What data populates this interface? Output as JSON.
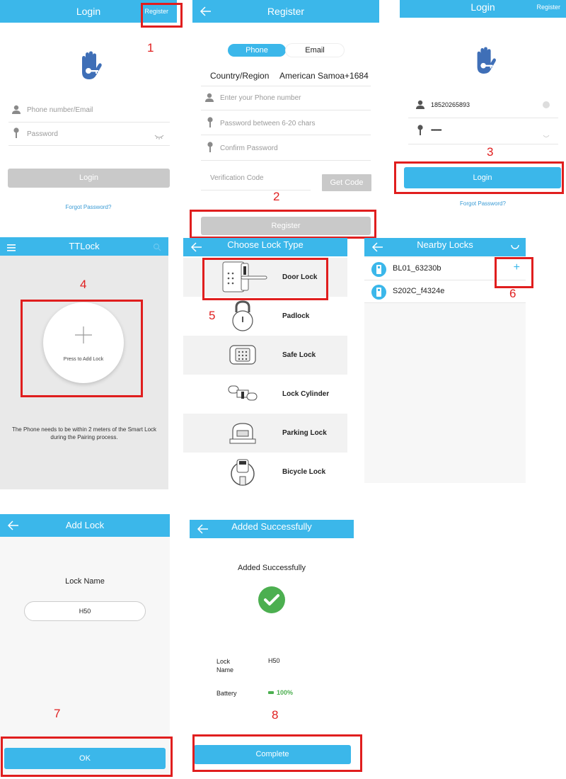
{
  "screen1": {
    "title": "Login",
    "register_link": "Register",
    "phone_placeholder": "Phone number/Email",
    "password_placeholder": "Password",
    "login_button": "Login",
    "forgot_link": "Forgot Password?"
  },
  "screen2": {
    "title": "Register",
    "tab_phone": "Phone",
    "tab_email": "Email",
    "country_label": "Country/Region",
    "country_value": "American Samoa+1684",
    "phone_placeholder": "Enter your Phone number",
    "password_placeholder": "Password between 6-20 chars",
    "confirm_placeholder": "Confirm Password",
    "code_placeholder": "Verification Code",
    "get_code_button": "Get Code",
    "register_button": "Register"
  },
  "screen3": {
    "title": "Login",
    "register_link": "Register",
    "phone_value": "18520265893",
    "password_value": "••••••••••",
    "login_button": "Login",
    "forgot_link": "Forgot Password?"
  },
  "screen4": {
    "title": "TTLock",
    "add_label": "Press to Add Lock",
    "hint": "The Phone needs to be within 2 meters of the Smart Lock during the Pairing process."
  },
  "screen5": {
    "title": "Choose Lock Type",
    "items": [
      {
        "label": "Door Lock",
        "icon": "door-lock-icon"
      },
      {
        "label": "Padlock",
        "icon": "padlock-icon"
      },
      {
        "label": "Safe Lock",
        "icon": "safe-lock-icon"
      },
      {
        "label": "Lock Cylinder",
        "icon": "lock-cylinder-icon"
      },
      {
        "label": "Parking Lock",
        "icon": "parking-lock-icon"
      },
      {
        "label": "Bicycle Lock",
        "icon": "bicycle-lock-icon"
      }
    ]
  },
  "screen6": {
    "title": "Nearby Locks",
    "locks": [
      {
        "name": "BL01_63230b",
        "action": "+"
      },
      {
        "name": "S202C_f4324e"
      }
    ]
  },
  "screen7": {
    "title": "Add Lock",
    "lock_name_label": "Lock Name",
    "lock_name_value": "H50",
    "ok_button": "OK"
  },
  "screen8": {
    "title": "Added Successfully",
    "heading": "Added Successfully",
    "lock_name_label": "Lock\nName",
    "lock_name_value": "H50",
    "battery_label": "Battery",
    "battery_value": "100%",
    "battery_level": 1.0,
    "complete_button": "Complete"
  },
  "steps": [
    "1",
    "2",
    "3",
    "4",
    "5",
    "6",
    "7",
    "8"
  ],
  "colors": {
    "accent": "#3bb7ea",
    "annotation": "#e01e1e",
    "success": "#4caf50",
    "link": "#3a9bd5",
    "disabled_button": "#c9c9c9"
  }
}
